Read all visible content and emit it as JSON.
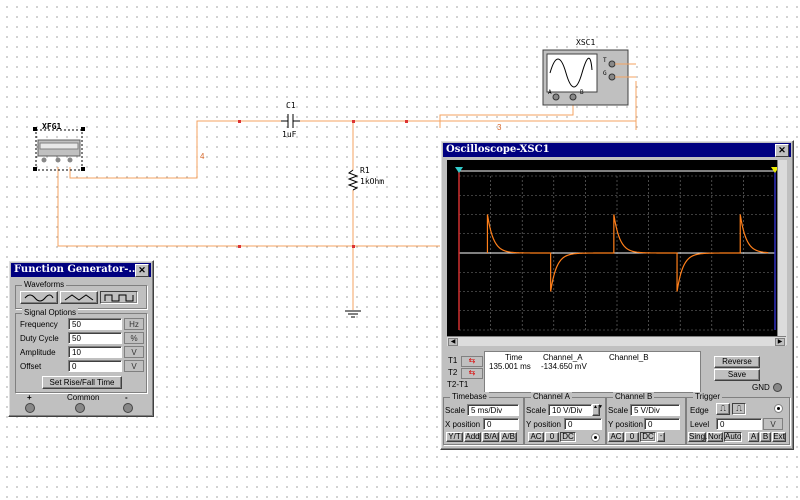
{
  "components": {
    "xfg1": "XFG1",
    "xsc1": "XSC1",
    "c1_name": "C1",
    "c1_value": "1uF",
    "r1_name": "R1",
    "r1_value": "1kOhm",
    "net_3": "3",
    "net_4": "4",
    "scope_term_a": "A",
    "scope_term_b": "B",
    "scope_term_t": "T",
    "scope_term_g": "G"
  },
  "function_generator": {
    "title": "Function Generator-...",
    "waveforms_label": "Waveforms",
    "signal_options_label": "Signal Options",
    "rows": [
      {
        "label": "Frequency",
        "value": "50",
        "unit": "Hz"
      },
      {
        "label": "Duty Cycle",
        "value": "50",
        "unit": "%"
      },
      {
        "label": "Amplitude",
        "value": "10",
        "unit": "V"
      },
      {
        "label": "Offset",
        "value": "0",
        "unit": "V"
      }
    ],
    "set_rise_fall": "Set Rise/Fall Time",
    "plus": "+",
    "common": "Common",
    "minus": "-"
  },
  "oscilloscope": {
    "title": "Oscilloscope-XSC1",
    "readout": {
      "t1": "T1",
      "t2": "T2",
      "t2t1": "T2-T1",
      "col_time": "Time",
      "col_cha": "Channel_A",
      "col_chb": "Channel_B",
      "time_value": "135.001 ms",
      "cha_value": "-134.650 mV",
      "chb_value": ""
    },
    "reverse": "Reverse",
    "save": "Save",
    "gnd": "GND",
    "timebase": {
      "label": "Timebase",
      "scale_label": "Scale",
      "scale": "5 ms/Div",
      "xpos_label": "X position",
      "xpos": "0",
      "modes": [
        "Y/T",
        "Add",
        "B/A",
        "A/B"
      ]
    },
    "channel_a": {
      "label": "Channel A",
      "scale_label": "Scale",
      "scale": "10  V/Div",
      "ypos_label": "Y position",
      "ypos": "0",
      "coupling": [
        "AC",
        "0",
        "DC"
      ]
    },
    "channel_b": {
      "label": "Channel B",
      "scale_label": "Scale",
      "scale": "5  V/Div",
      "ypos_label": "Y position",
      "ypos": "0",
      "coupling": [
        "AC",
        "0",
        "DC"
      ]
    },
    "trigger": {
      "label": "Trigger",
      "edge_label": "Edge",
      "level_label": "Level",
      "level": "0",
      "level_unit": "V",
      "modes": [
        "Sing.",
        "Nor.",
        "Auto"
      ],
      "sources": [
        "A",
        "B",
        "Ext"
      ]
    }
  }
}
